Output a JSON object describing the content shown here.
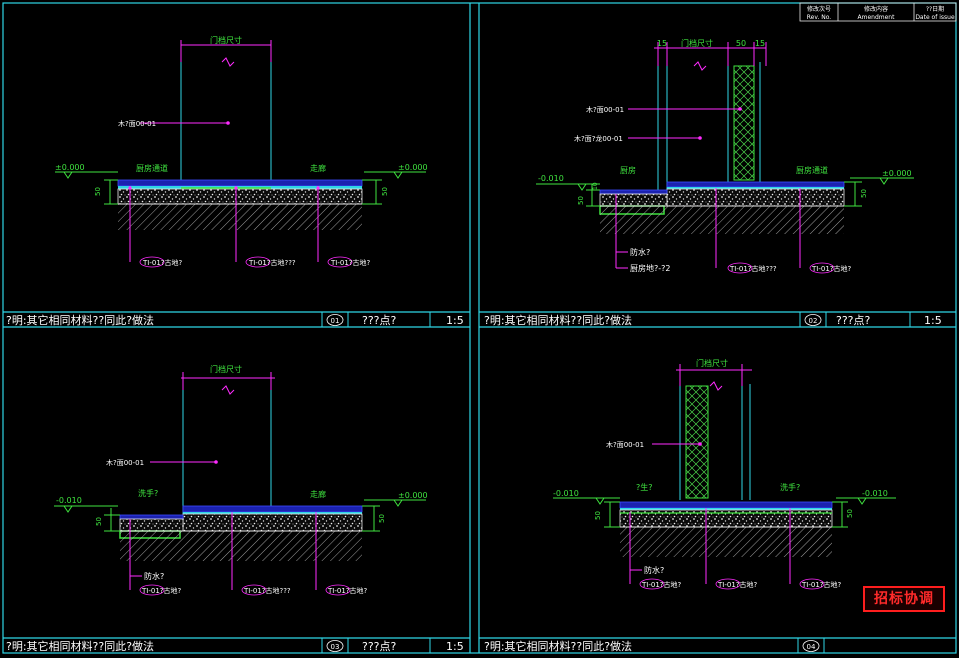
{
  "revision_table": {
    "headers": [
      {
        "top": "修改次号",
        "bottom": "Rev. No."
      },
      {
        "top": "修改内容",
        "bottom": "Amendment"
      },
      {
        "top": "??日期",
        "bottom": "Date of issue"
      }
    ]
  },
  "colors": {
    "background": "#000000",
    "frame": "#2fd6e6",
    "dimension": "#3fe33f",
    "leader": "#ff2bff",
    "text": "#ffffff",
    "stamp": "#ff1e1e"
  },
  "panels": [
    {
      "id": "01",
      "title_note": "?明:其它相同材料??同此?做法",
      "detail_name": "???点?",
      "scale": "1:5",
      "dim_top": "门档尺寸",
      "dims_side": [
        "50"
      ],
      "level_left": "±0.000",
      "level_right": "±0.000",
      "room_left": "厨房通道",
      "room_right": "走廊",
      "material_label": "木?面00-01",
      "bottom_tags": [
        "TI-01?古地?",
        "TI-01?古地???",
        "TI-01?古地?"
      ]
    },
    {
      "id": "02",
      "title_note": "?明:其它相同材料??同此?做法",
      "detail_name": "???点?",
      "scale": "1:5",
      "dim_top": "门档尺寸",
      "dims_top_small": [
        "15",
        "50",
        "15"
      ],
      "dims_side": [
        "50",
        "10"
      ],
      "level_left": "-0.010",
      "level_right": "±0.000",
      "room_left": "厨房",
      "room_right": "厨房通道",
      "material_labels": [
        "木?面00-01",
        "木?面?龙00-01"
      ],
      "side_tags": [
        "防水?",
        "厨房地?-?2"
      ],
      "bottom_tags": [
        "TI-01?古地???",
        "TI-01?古地?"
      ]
    },
    {
      "id": "03",
      "title_note": "?明:其它相同材料??同此?做法",
      "detail_name": "???点?",
      "scale": "1:5",
      "dim_top": "门档尺寸",
      "dims_side": [
        "50"
      ],
      "level_left": "-0.010",
      "level_right": "±0.000",
      "room_left": "洗手?",
      "room_right": "走廊",
      "material_label": "木?面00-01",
      "side_tags": [
        "防水?"
      ],
      "bottom_tags": [
        "TI-01?古地???",
        "TI-01?古地?"
      ]
    },
    {
      "id": "04",
      "title_note": "?明:其它相同材料??同此?做法",
      "detail_name": "",
      "scale": "",
      "dim_top": "门档尺寸",
      "dims_side": [
        "50"
      ],
      "level_left": "-0.010",
      "level_right": "-0.010",
      "room_left": "?生?",
      "room_right": "洗手?",
      "material_label": "木?面00-01",
      "side_tags": [
        "防水?"
      ],
      "bottom_tags": [
        "TI-01?古地?",
        "TI-01?古地?",
        "TI-01?古地?"
      ]
    }
  ],
  "stamp": "招标协调"
}
